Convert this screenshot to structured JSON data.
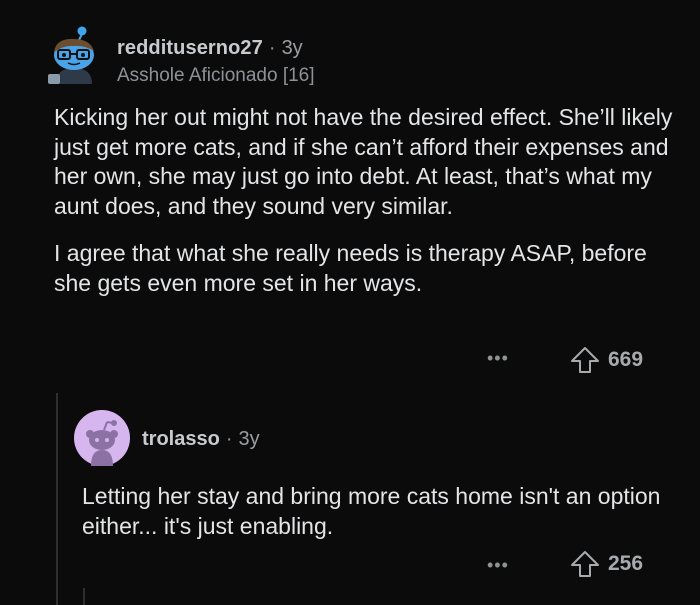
{
  "comment": {
    "username": "reddituserno27",
    "separator": "·",
    "age": "3y",
    "flair": "Asshole Aficionado [16]",
    "paragraphs": [
      "Kicking her out might not have the desired effect. She’ll likely just get more cats, and if she can’t afford their expenses and her own, she may just go into debt. At least, that’s what my aunt does, and they sound very similar.",
      "I agree that what she really needs is therapy ASAP, before she gets even more set in her ways."
    ],
    "more_label": "•••",
    "votes": "669",
    "avatar_icon": "snoo-avatar-glasses-icon"
  },
  "reply": {
    "username": "trolasso",
    "separator": "·",
    "age": "3y",
    "text": "Letting her stay and bring more cats home isn't an option either... it's just enabling.",
    "more_label": "•••",
    "votes": "256",
    "avatar_icon": "default-snoo-avatar-icon"
  },
  "colors": {
    "background": "#0b0b0c",
    "text": "#e3e5e7",
    "muted": "#8e9295",
    "reply_avatar_bg": "#d7b6f0"
  }
}
